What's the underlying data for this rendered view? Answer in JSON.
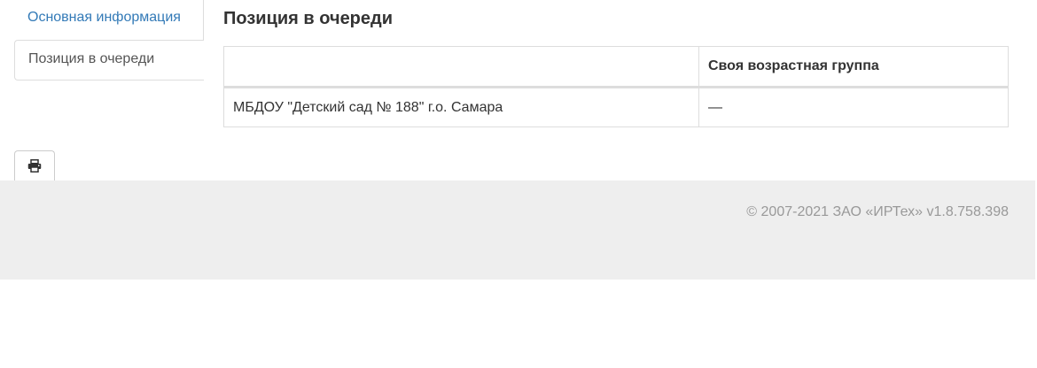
{
  "sidebar": {
    "items": [
      {
        "label": "Основная информация",
        "active": false
      },
      {
        "label": "Позиция в очереди",
        "active": true
      }
    ]
  },
  "main": {
    "title": "Позиция в очереди",
    "table": {
      "headers": [
        "",
        "Своя возрастная группа"
      ],
      "rows": [
        [
          "МБДОУ \"Детский сад № 188\" г.о. Самара",
          "—"
        ]
      ]
    }
  },
  "toolbar": {
    "print_icon": "print-icon"
  },
  "footer": {
    "copyright": "© 2007-2021 ЗАО «ИРТех» v1.8.758.398"
  },
  "colors": {
    "link": "#337ab7",
    "border": "#dddddd",
    "footer_bg": "#eeeeee",
    "footer_text": "#999999"
  }
}
